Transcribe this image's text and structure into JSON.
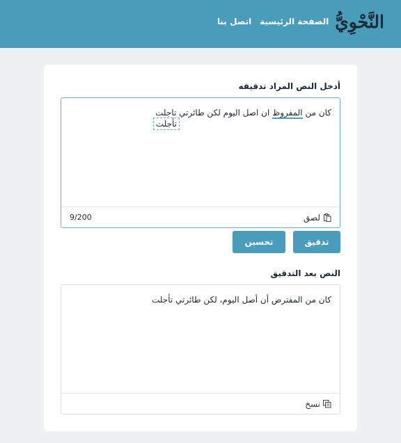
{
  "header": {
    "logo_text": "النَّحْوِيُّ",
    "nav": [
      {
        "label": "الصفحة الرئيسية"
      },
      {
        "label": "اتصل بنا"
      }
    ]
  },
  "input_section": {
    "label": "أدخل النص المراد تدقيقه",
    "text_before": "كان من ",
    "err1": "المفروظ",
    "text_middle": " ان اصل اليوم لكن طائرتي ",
    "err2": "تاجلت",
    "suggestion": "تأجلت",
    "paste_label": "لصق",
    "counter": "9/200"
  },
  "buttons": {
    "check": "تدقيق",
    "improve": "تحسين"
  },
  "output_section": {
    "label": "النص بعد التدقيق",
    "text": "كان من المفترض أن أصل اليوم، لكن طائرتي تأجلت",
    "copy_label": "نسخ"
  },
  "colors": {
    "primary": "#4a9dba",
    "background": "#eef1f4"
  }
}
